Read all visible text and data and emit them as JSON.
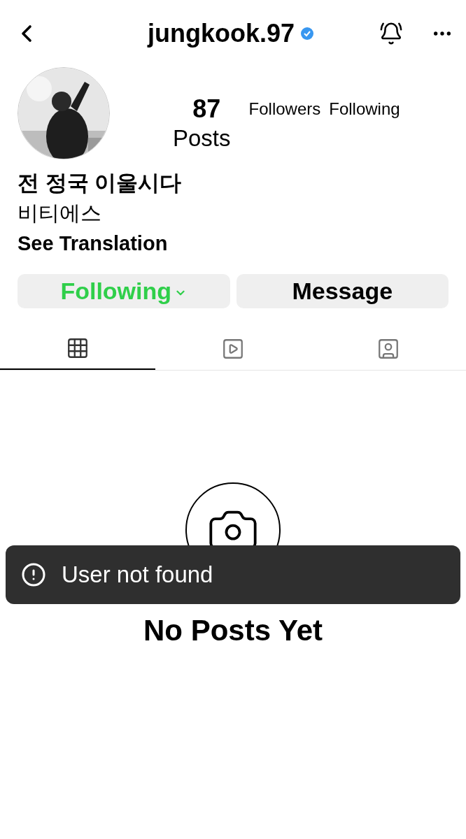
{
  "header": {
    "title": "jungkook.97",
    "verified": true
  },
  "profile": {
    "stats": [
      {
        "value": "87",
        "label": "Posts"
      },
      {
        "label": "Followers"
      },
      {
        "label": "Following"
      }
    ],
    "name": "전 정국 이울시다",
    "bio": "비티에스",
    "translation_link": "See Translation"
  },
  "buttons": [
    {
      "kind": "following",
      "label": "Following"
    },
    {
      "kind": "message",
      "label": "Message"
    }
  ],
  "tabs": [
    {
      "kind": "grid",
      "selected": true
    },
    {
      "kind": "reels",
      "selected": false
    },
    {
      "kind": "tagged",
      "selected": false
    }
  ],
  "empty_state": {
    "title": "No Posts Yet"
  },
  "toast": {
    "message": "User not found"
  }
}
